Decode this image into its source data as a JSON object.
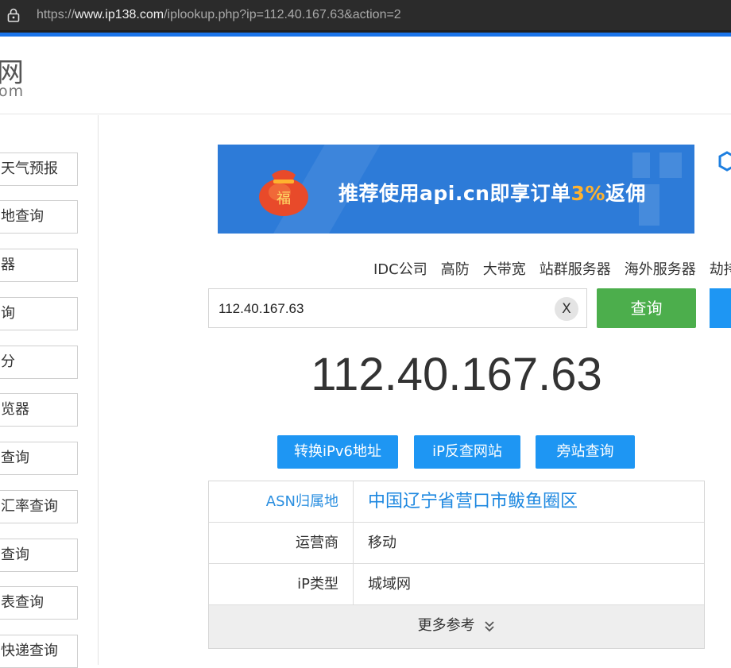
{
  "browser": {
    "url_prefix": "https://",
    "url_host": "www.ip138.com",
    "url_path": "/iplookup.php?ip=112.40.167.63&action=2",
    "lock_icon": "lock-icon"
  },
  "header": {
    "logo_main": "网",
    "logo_sub": "om"
  },
  "sidebar": {
    "items": [
      {
        "label": "天气预报"
      },
      {
        "label": "地查询"
      },
      {
        "label": "器"
      },
      {
        "label": "询"
      },
      {
        "label": "分"
      },
      {
        "label": "览器"
      },
      {
        "label": "查询"
      },
      {
        "label": "汇率查询"
      },
      {
        "label": "查询"
      },
      {
        "label": "表查询"
      },
      {
        "label": "快递查询"
      }
    ]
  },
  "banner": {
    "text_before": "推荐使用api.cn即享订单",
    "text_highlight": "3%",
    "text_after": "返佣",
    "bag_char": "福",
    "accent": "#ffb22e"
  },
  "quick_links": [
    "IDC公司",
    "高防",
    "大带宽",
    "站群服务器",
    "海外服务器",
    "劫持"
  ],
  "search": {
    "value": "112.40.167.63",
    "clear_label": "X",
    "query_label": "查询"
  },
  "result": {
    "ip": "112.40.167.63",
    "actions": [
      "转换iPv6地址",
      "iP反查网站",
      "旁站查询"
    ],
    "rows": [
      {
        "key": "ASN归属地",
        "value": "中国辽宁省营口市鲅鱼圈区"
      },
      {
        "key": "运营商",
        "value": "移动"
      },
      {
        "key": "iP类型",
        "value": "城域网"
      }
    ],
    "more_label": "更多参考"
  },
  "colors": {
    "green": "#4cae4c",
    "blue": "#1e96f3",
    "link_blue": "#1e88e0"
  }
}
